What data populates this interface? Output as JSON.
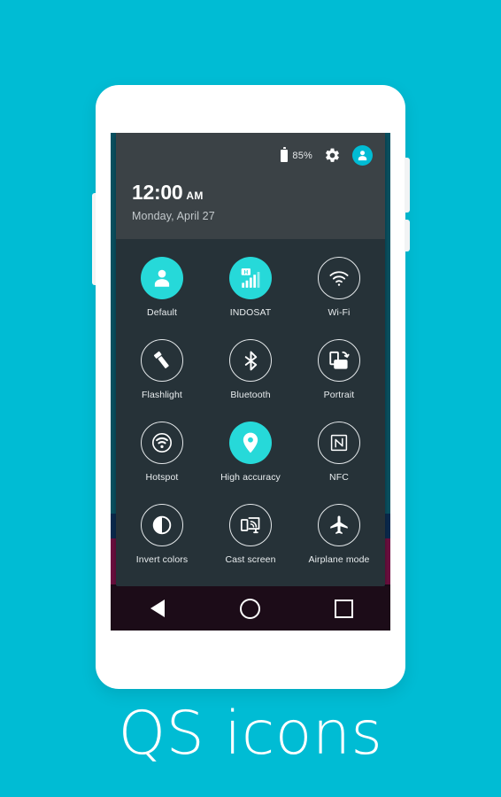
{
  "app": {
    "caption": "QS icons",
    "background_color": "#00bcd4",
    "accent_color": "#26d9d9",
    "panel_color": "#263238",
    "header_color": "#3b4246"
  },
  "statusbar": {
    "battery_percent": "85%",
    "battery_icon": "battery-icon",
    "settings_icon": "gear-icon",
    "avatar_icon": "user-avatar-icon"
  },
  "clock": {
    "time": "12:00",
    "ampm": "AM",
    "date": "Monday, April 27"
  },
  "tiles": [
    {
      "label": "Default",
      "icon": "user-icon",
      "state": "on"
    },
    {
      "label": "INDOSAT",
      "icon": "signal-bars-icon",
      "state": "on"
    },
    {
      "label": "Wi-Fi",
      "icon": "wifi-icon",
      "state": "off"
    },
    {
      "label": "Flashlight",
      "icon": "flashlight-icon",
      "state": "off"
    },
    {
      "label": "Bluetooth",
      "icon": "bluetooth-icon",
      "state": "off"
    },
    {
      "label": "Portrait",
      "icon": "rotation-icon",
      "state": "off"
    },
    {
      "label": "Hotspot",
      "icon": "hotspot-icon",
      "state": "off"
    },
    {
      "label": "High accuracy",
      "icon": "location-pin-icon",
      "state": "on"
    },
    {
      "label": "NFC",
      "icon": "nfc-icon",
      "state": "off"
    },
    {
      "label": "Invert colors",
      "icon": "invert-colors-icon",
      "state": "off"
    },
    {
      "label": "Cast screen",
      "icon": "cast-screen-icon",
      "state": "off"
    },
    {
      "label": "Airplane mode",
      "icon": "airplane-icon",
      "state": "off"
    }
  ],
  "navbar": {
    "back": "back-nav-icon",
    "home": "home-nav-icon",
    "recents": "recents-nav-icon"
  },
  "wallpaper_colors": [
    "#0a5161",
    "#0b2a4e",
    "#6b0f3f",
    "#1b0a18"
  ]
}
